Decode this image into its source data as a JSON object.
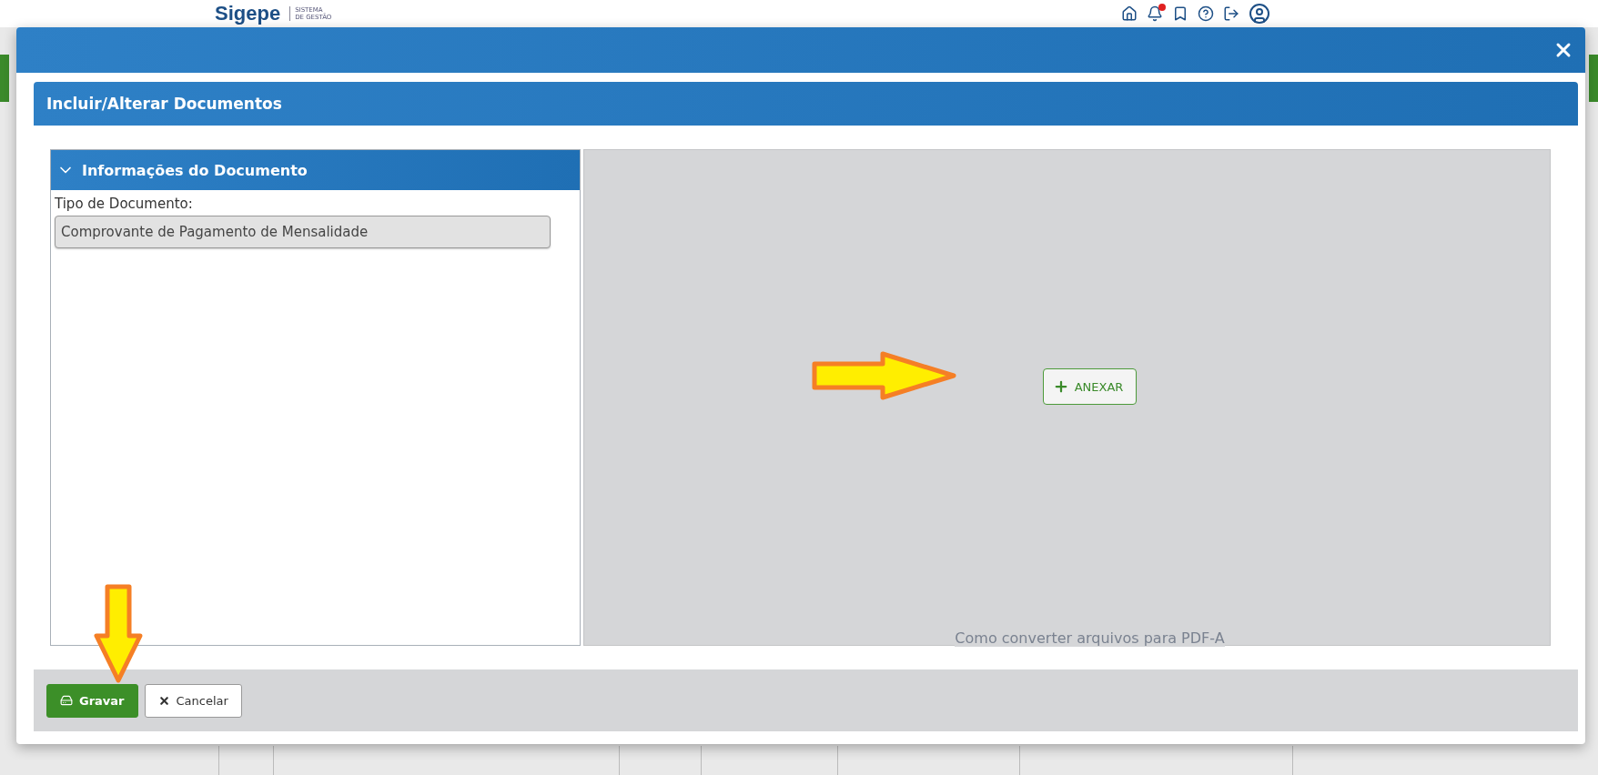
{
  "app_header": {
    "logo": "Sigepe",
    "subtitle_lines": [
      "SISTEMA",
      "DE GESTÃO"
    ],
    "notification_dot": true
  },
  "dialog": {
    "panel_title": "Incluir/Alterar Documentos",
    "section": {
      "title": "Informações do Documento",
      "expanded": true,
      "field_label": "Tipo de Documento:",
      "field_value": "Comprovante de Pagamento de Mensalidade"
    },
    "attach_button": "ANEXAR",
    "help_link": "Como converter arquivos para PDF-A",
    "buttons": [
      {
        "kind": "primary",
        "label": "Gravar"
      },
      {
        "kind": "secondary",
        "label": "Cancelar"
      }
    ]
  }
}
